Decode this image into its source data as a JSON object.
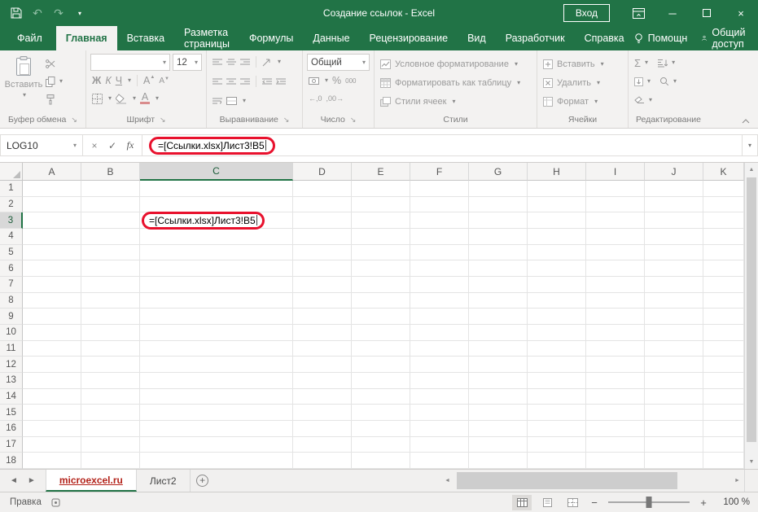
{
  "colors": {
    "excel_green": "#217346",
    "highlight_red": "#e8112d",
    "active_sheet_text": "#b3231a"
  },
  "title_bar": {
    "title": "Создание ссылок - Excel",
    "login": "Вход"
  },
  "ribbon_tabs": [
    {
      "label": "Файл",
      "file": true
    },
    {
      "label": "Главная",
      "active": true
    },
    {
      "label": "Вставка"
    },
    {
      "label": "Разметка страницы"
    },
    {
      "label": "Формулы"
    },
    {
      "label": "Данные"
    },
    {
      "label": "Рецензирование"
    },
    {
      "label": "Вид"
    },
    {
      "label": "Разработчик"
    },
    {
      "label": "Справка"
    }
  ],
  "tab_strip_right": {
    "assistant": "Помощн",
    "share": "Общий доступ"
  },
  "ribbon": {
    "clipboard": {
      "paste": "Вставить",
      "label": "Буфер обмена"
    },
    "font": {
      "name": "",
      "size": "12",
      "bold": "Ж",
      "italic": "К",
      "underline": "Ч",
      "grow": "А",
      "shrink": "А",
      "color": "А",
      "label": "Шрифт"
    },
    "alignment": {
      "label": "Выравнивание"
    },
    "number": {
      "format": "Общий",
      "percent": "%",
      "thousands": "000",
      "decimal_inc": "←,0",
      "decimal_dec": ",00→",
      "label": "Число"
    },
    "styles": {
      "conditional": "Условное форматирование",
      "as_table": "Форматировать как таблицу",
      "cell_styles": "Стили ячеек",
      "label": "Стили"
    },
    "cells": {
      "insert": "Вставить",
      "delete": "Удалить",
      "format": "Формат",
      "label": "Ячейки"
    },
    "editing": {
      "sigma": "Σ",
      "label": "Редактирование"
    }
  },
  "formula_bar": {
    "name_box": "LOG10",
    "cancel": "×",
    "enter": "✓",
    "fx": "fx",
    "formula": "=[Ссылки.xlsx]Лист3!B5"
  },
  "grid": {
    "columns": [
      "A",
      "B",
      "C",
      "D",
      "E",
      "F",
      "G",
      "H",
      "I",
      "J",
      "K"
    ],
    "row_count": 18,
    "selected_column": "C",
    "selected_row": 3,
    "edit_cell": {
      "col": "C",
      "row": 3,
      "text": "=[Ссылки.xlsx]Лист3!B5"
    }
  },
  "sheet_bar": {
    "tabs": [
      {
        "label": "microexcel.ru",
        "active": true
      },
      {
        "label": "Лист2"
      }
    ]
  },
  "status_bar": {
    "mode": "Правка",
    "zoom": "100 %"
  }
}
